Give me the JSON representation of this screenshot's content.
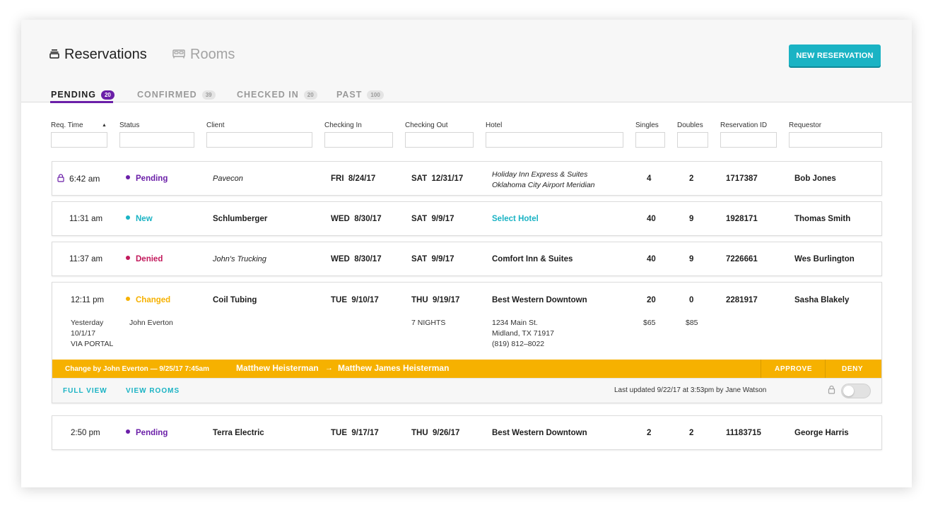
{
  "header": {
    "reservations_label": "Reservations",
    "rooms_label": "Rooms",
    "new_reservation_label": "NEW RESERVATION",
    "tabs": [
      {
        "label": "PENDING",
        "count": "20"
      },
      {
        "label": "CONFIRMED",
        "count": "39"
      },
      {
        "label": "CHECKED IN",
        "count": "20"
      },
      {
        "label": "PAST",
        "count": "100"
      }
    ]
  },
  "filters": {
    "req_time": "Req. Time",
    "status": "Status",
    "client": "Client",
    "checking_in": "Checking In",
    "checking_out": "Checking Out",
    "hotel": "Hotel",
    "singles": "Singles",
    "doubles": "Doubles",
    "reservation_id": "Reservation ID",
    "requestor": "Requestor",
    "sort_arrow": "▲"
  },
  "rows": [
    {
      "time": "6:42 am",
      "status": "Pending",
      "client": "Pavecon",
      "check_in": "FRI  8/24/17",
      "check_out": "SAT  12/31/17",
      "hotel_line1": "Holiday Inn Express & Suites",
      "hotel_line2": "Oklahoma City Airport Meridian",
      "singles": "4",
      "doubles": "2",
      "reservation_id": "1717387",
      "requestor": "Bob Jones"
    },
    {
      "time": "11:31 am",
      "status": "New",
      "client": "Schlumberger",
      "check_in": "WED  8/30/17",
      "check_out": "SAT  9/9/17",
      "hotel": "Select Hotel",
      "singles": "40",
      "doubles": "9",
      "reservation_id": "1928171",
      "requestor": "Thomas Smith"
    },
    {
      "time": "11:37 am",
      "status": "Denied",
      "client": "John's Trucking",
      "check_in": "WED  8/30/17",
      "check_out": "SAT  9/9/17",
      "hotel": "Comfort Inn & Suites",
      "singles": "40",
      "doubles": "9",
      "reservation_id": "7226661",
      "requestor": "Wes Burlington"
    },
    {
      "time": "12:11 pm",
      "status": "Changed",
      "client": "Coil Tubing",
      "check_in": "TUE  9/10/17",
      "check_out": "THU  9/19/17",
      "hotel": "Best Western Downtown",
      "singles": "20",
      "doubles": "0",
      "reservation_id": "2281917",
      "requestor": "Sasha Blakely",
      "req_detail_1": "Yesterday",
      "req_detail_2": "10/1/17",
      "req_detail_3": "VIA PORTAL",
      "client_contact": "John Everton",
      "nights": "7 NIGHTS",
      "address_1": "1234 Main St.",
      "address_2": "Midland, TX 71917",
      "phone": "(819) 812–8022",
      "single_rate": "$65",
      "double_rate": "$85",
      "change_by": "Change by John Everton — 9/25/17 7:45am",
      "change_from": "Matthew Heisterman",
      "change_arrow": "→",
      "change_to": "Matthew James Heisterman",
      "approve_label": "APPROVE",
      "deny_label": "DENY",
      "full_view_label": "FULL VIEW",
      "view_rooms_label": "VIEW ROOMS",
      "last_updated": "Last updated 9/22/17 at 3:53pm by Jane Watson"
    },
    {
      "time": "2:50 pm",
      "status": "Pending",
      "client": "Terra Electric",
      "check_in": "TUE  9/17/17",
      "check_out": "THU  9/26/17",
      "hotel": "Best Western Downtown",
      "singles": "2",
      "doubles": "2",
      "reservation_id": "11183715",
      "requestor": "George Harris"
    }
  ],
  "colors": {
    "accent_purple": "#6b1fa8",
    "teal": "#1ab3c4",
    "denied": "#c2185b",
    "changed": "#f6b100"
  },
  "icons": {
    "reservations": "stack-icon",
    "rooms": "bed-icon",
    "lock": "lock-icon"
  }
}
